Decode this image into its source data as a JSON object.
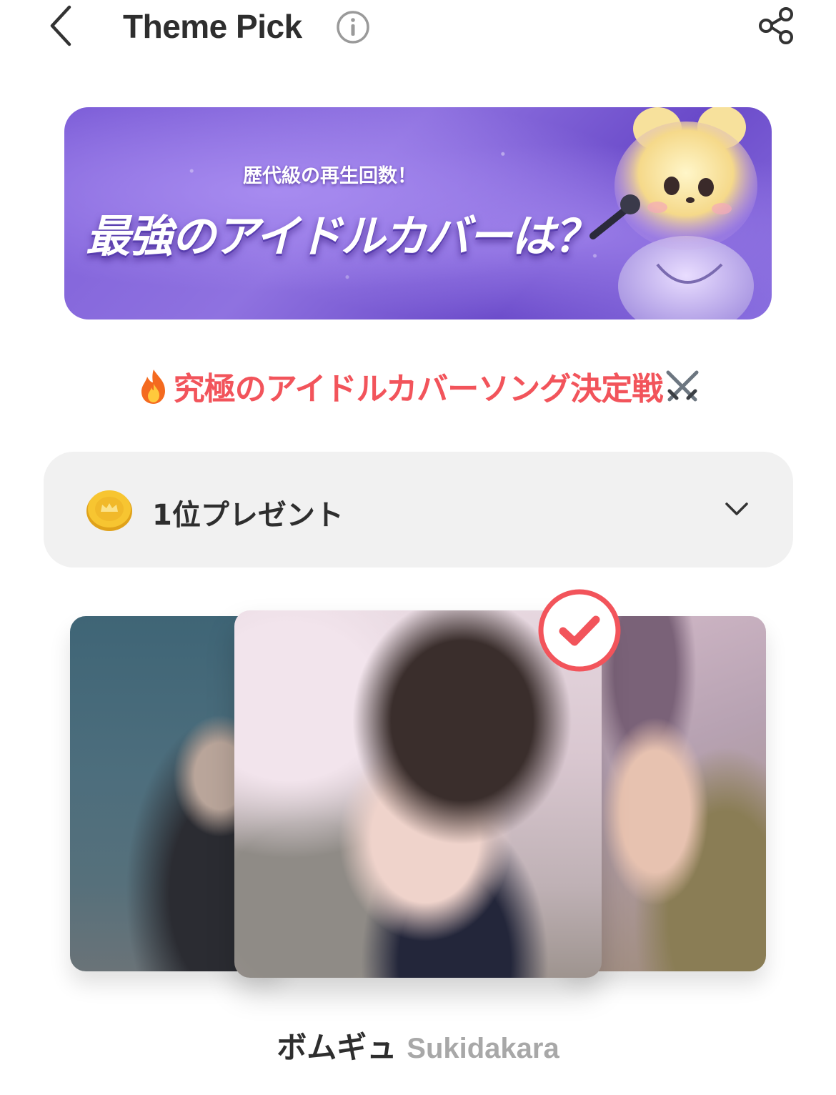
{
  "header": {
    "title": "Theme Pick",
    "back_icon": "chevron-left-icon",
    "info_icon": "info-icon",
    "share_icon": "share-icon"
  },
  "banner": {
    "subtitle": "歴代級の再生回数！",
    "headline": "最強のアイドルカバーは？"
  },
  "event": {
    "heading": "究極のアイドルカバーソング決定戦",
    "leading_icon": "fire-icon",
    "trailing_icon": "crossed-swords-icon"
  },
  "reward": {
    "label": "1位プレゼント",
    "icon": "coin-icon",
    "toggle_icon": "chevron-down-icon"
  },
  "carousel": {
    "selected": {
      "name": "ボムギュ",
      "song": "Sukidakara"
    },
    "check_icon": "checkmark-icon"
  },
  "colors": {
    "accent": "#f2545b",
    "panel": "#f1f1f1",
    "banner_purple": "#7d5ed8"
  }
}
